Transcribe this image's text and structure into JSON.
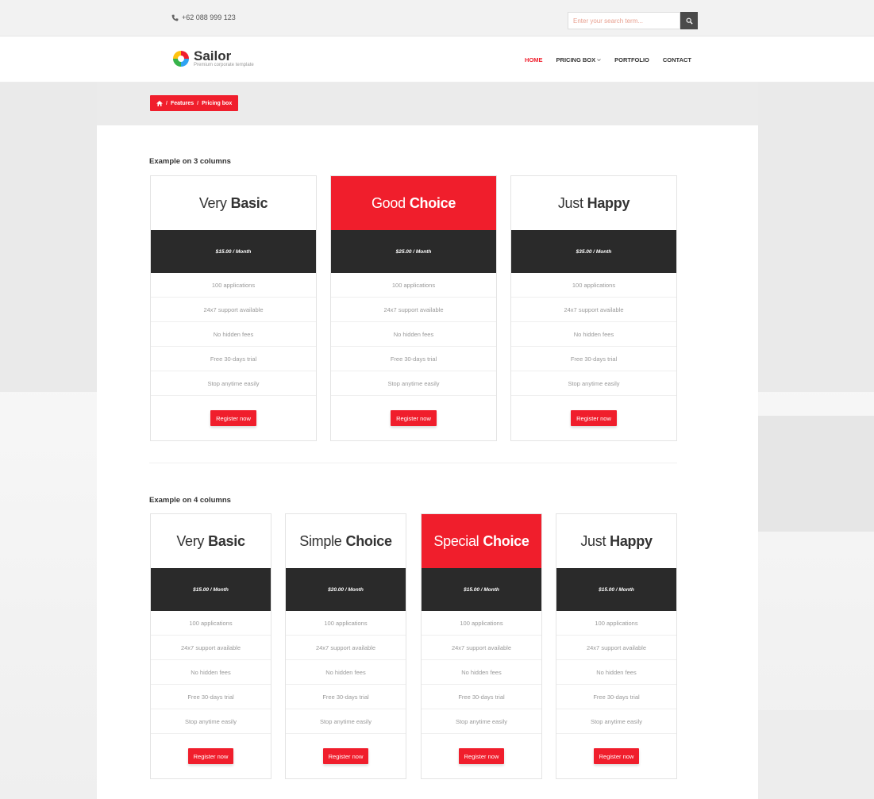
{
  "topbar": {
    "phone": "+62 088 999 123",
    "search_placeholder": "Enter your search term..."
  },
  "header": {
    "logo_name": "Sailor",
    "logo_tagline": "Premium corporate template",
    "nav": [
      {
        "label": "HOME",
        "active": true
      },
      {
        "label": "PRICING BOX",
        "active": false,
        "dropdown": true
      },
      {
        "label": "PORTFOLIO",
        "active": false
      },
      {
        "label": "CONTACT",
        "active": false
      }
    ]
  },
  "breadcrumb": {
    "items": [
      "Features",
      "Pricing box"
    ],
    "separator": "/"
  },
  "sections": [
    {
      "title": "Example on 3 columns",
      "plans": [
        {
          "light": "Very",
          "bold": "Basic",
          "price": "$15.00 / Month",
          "featured": false
        },
        {
          "light": "Good",
          "bold": "Choice",
          "price": "$25.00 / Month",
          "featured": true
        },
        {
          "light": "Just",
          "bold": "Happy",
          "price": "$35.00 / Month",
          "featured": false
        }
      ]
    },
    {
      "title": "Example on 4 columns",
      "plans": [
        {
          "light": "Very",
          "bold": "Basic",
          "price": "$15.00 / Month",
          "featured": false
        },
        {
          "light": "Simple",
          "bold": "Choice",
          "price": "$20.00 / Month",
          "featured": false
        },
        {
          "light": "Special",
          "bold": "Choice",
          "price": "$15.00 / Month",
          "featured": true
        },
        {
          "light": "Just",
          "bold": "Happy",
          "price": "$15.00 / Month",
          "featured": false
        }
      ]
    }
  ],
  "features": [
    "100 applications",
    "24x7 support available",
    "No hidden fees",
    "Free 30-days trial",
    "Stop anytime easily"
  ],
  "register_label": "Register now",
  "colors": {
    "accent": "#f01e2c",
    "price_band": "#2a2a2a"
  }
}
